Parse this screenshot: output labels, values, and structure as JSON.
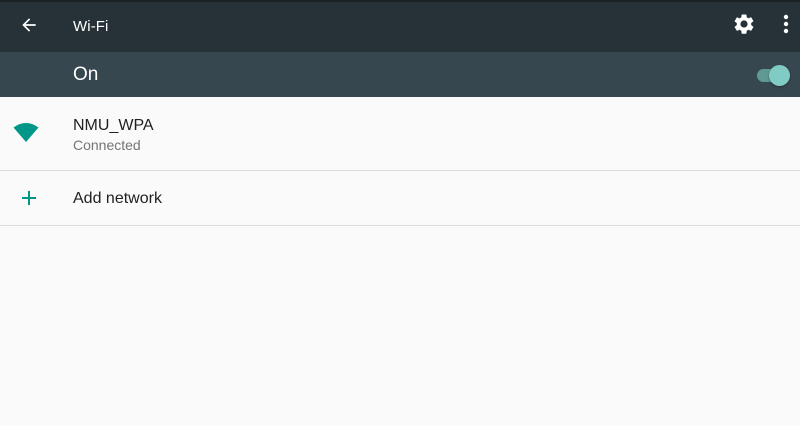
{
  "app_bar": {
    "title": "Wi-Fi",
    "back_icon": "arrow-back-icon",
    "settings_icon": "gear-icon",
    "overflow_icon": "more-vert-icon",
    "background_color": "#263238"
  },
  "master_switch": {
    "label": "On",
    "state": "on",
    "background_color": "#37474f",
    "accent_color": "#80cbc4"
  },
  "networks": [
    {
      "ssid": "NMU_WPA",
      "status": "Connected",
      "icon": "wifi-signal-icon",
      "icon_color": "#009688"
    }
  ],
  "add_network": {
    "label": "Add network",
    "icon": "plus-icon",
    "icon_color": "#009688"
  }
}
